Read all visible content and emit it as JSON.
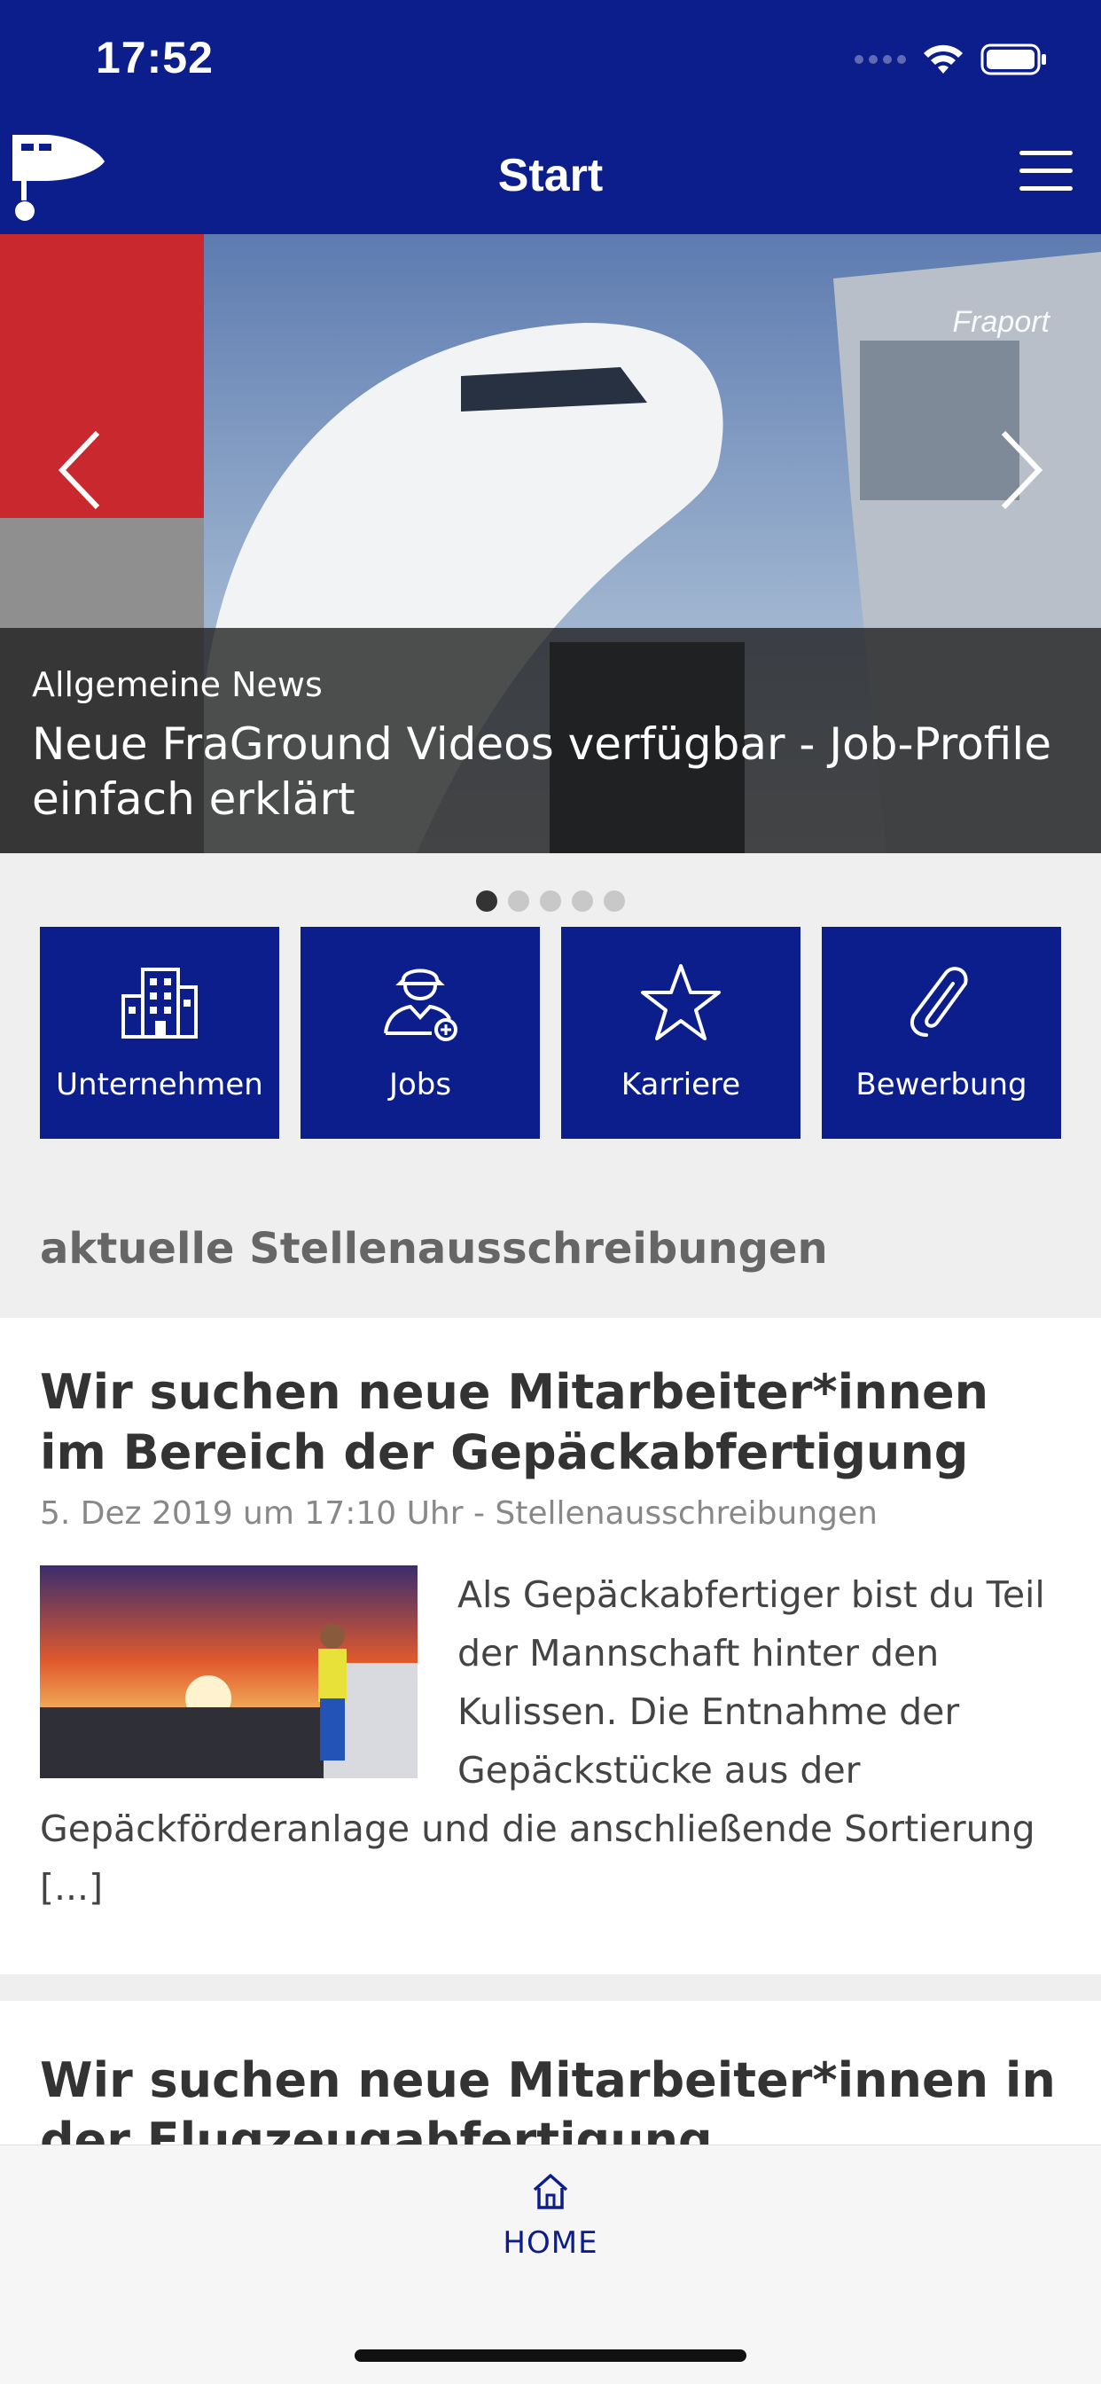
{
  "status_bar": {
    "time": "17:52"
  },
  "header": {
    "title": "Start"
  },
  "hero": {
    "category": "Allgemeine News",
    "title": "Neue FraGround Videos verfügbar - Job-Profile einfach erklärt",
    "watermark": "Fraport",
    "slide_count": 5,
    "active_slide": 1
  },
  "tiles": [
    {
      "label": "Unternehmen",
      "icon": "building-icon"
    },
    {
      "label": "Jobs",
      "icon": "worker-icon"
    },
    {
      "label": "Karriere",
      "icon": "star-icon"
    },
    {
      "label": "Bewerbung",
      "icon": "paperclip-icon"
    }
  ],
  "section": {
    "heading": "aktuelle Stellenausschreibungen"
  },
  "articles": [
    {
      "title": "Wir suchen neue Mitarbeiter*innen im Bereich der Gepäckabfertigung",
      "meta": "5. Dez 2019 um 17:10 Uhr - Stellenausschreibungen",
      "excerpt": "Als Gepäckabfertiger bist du Teil der Mannschaft hinter den Kulissen. Die Entnahme der Gepäckstücke aus der Gepäckförderanlage und die anschließende Sortierung [...]"
    },
    {
      "title": "Wir suchen neue Mitarbeiter*innen in der Flugzeugabfertigung"
    }
  ],
  "bottom_nav": {
    "home_label": "HOME"
  },
  "colors": {
    "primary": "#0c1d8c",
    "background": "#efefef"
  }
}
